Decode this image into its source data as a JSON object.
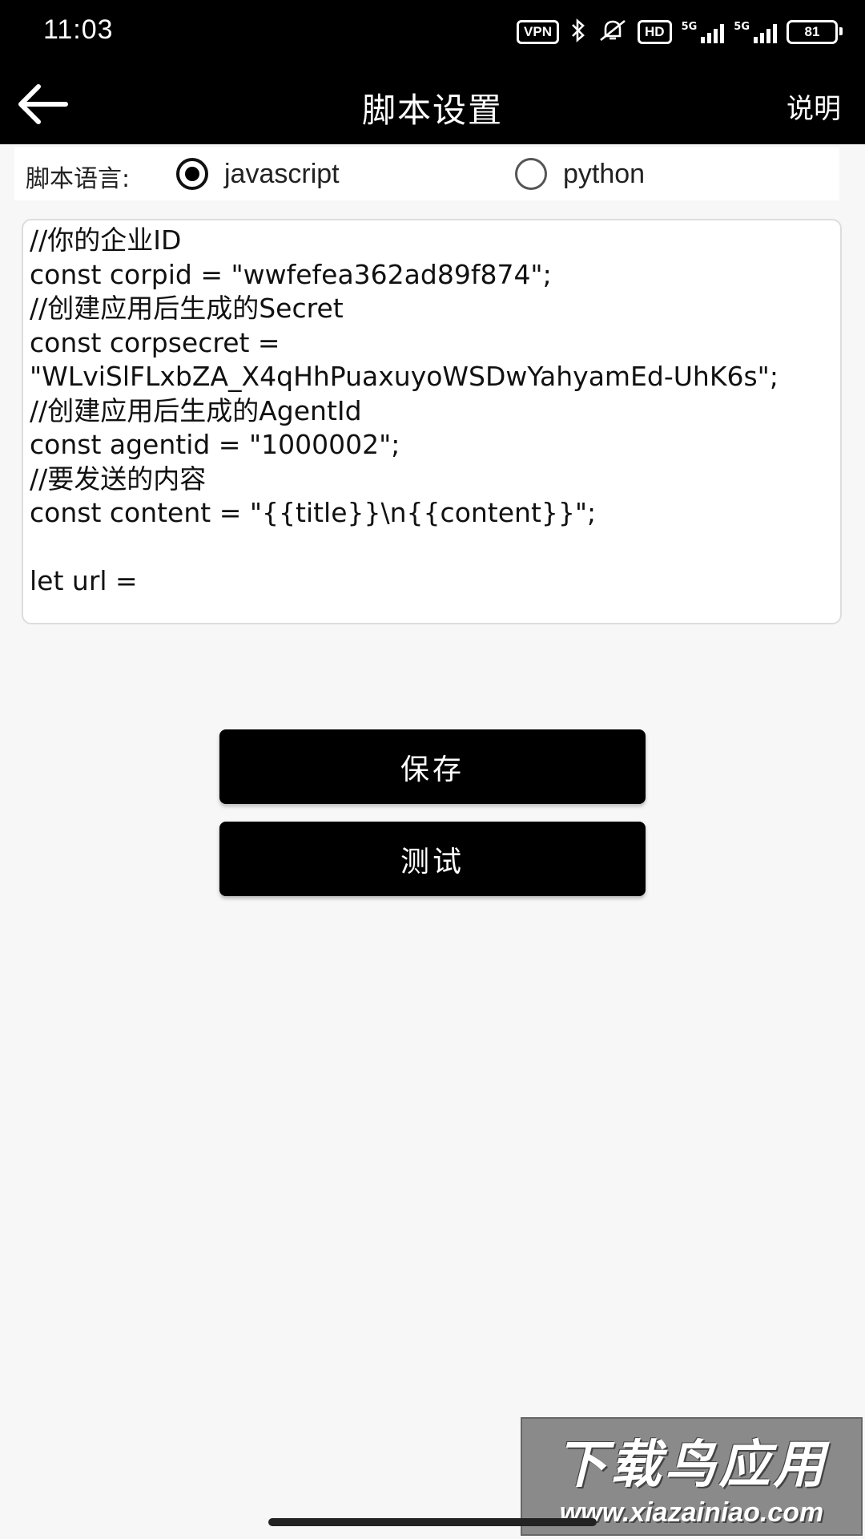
{
  "status_bar": {
    "time": "11:03",
    "vpn": "VPN",
    "hd": "HD",
    "network1": "5G",
    "network2": "5G",
    "battery": "81"
  },
  "app_bar": {
    "title": "脚本设置",
    "action": "说明"
  },
  "language": {
    "label": "脚本语言:",
    "options": [
      {
        "label": "javascript",
        "selected": true
      },
      {
        "label": "python",
        "selected": false
      }
    ]
  },
  "editor": {
    "content": "//你的企业ID\nconst corpid = \"wwfefea362ad89f874\";\n//创建应用后生成的Secret\nconst corpsecret =\n\"WLviSlFLxbZA_X4qHhPuaxuyoWSDwYahyamEd-UhK6s\";\n//创建应用后生成的AgentId\nconst agentid = \"1000002\";\n//要发送的内容\nconst content = \"{{title}}\\n{{content}}\";\n\nlet url ="
  },
  "buttons": {
    "save": "保存",
    "test": "测试"
  },
  "watermark": {
    "title": "下载鸟应用",
    "url": "www.xiazainiao.com"
  }
}
